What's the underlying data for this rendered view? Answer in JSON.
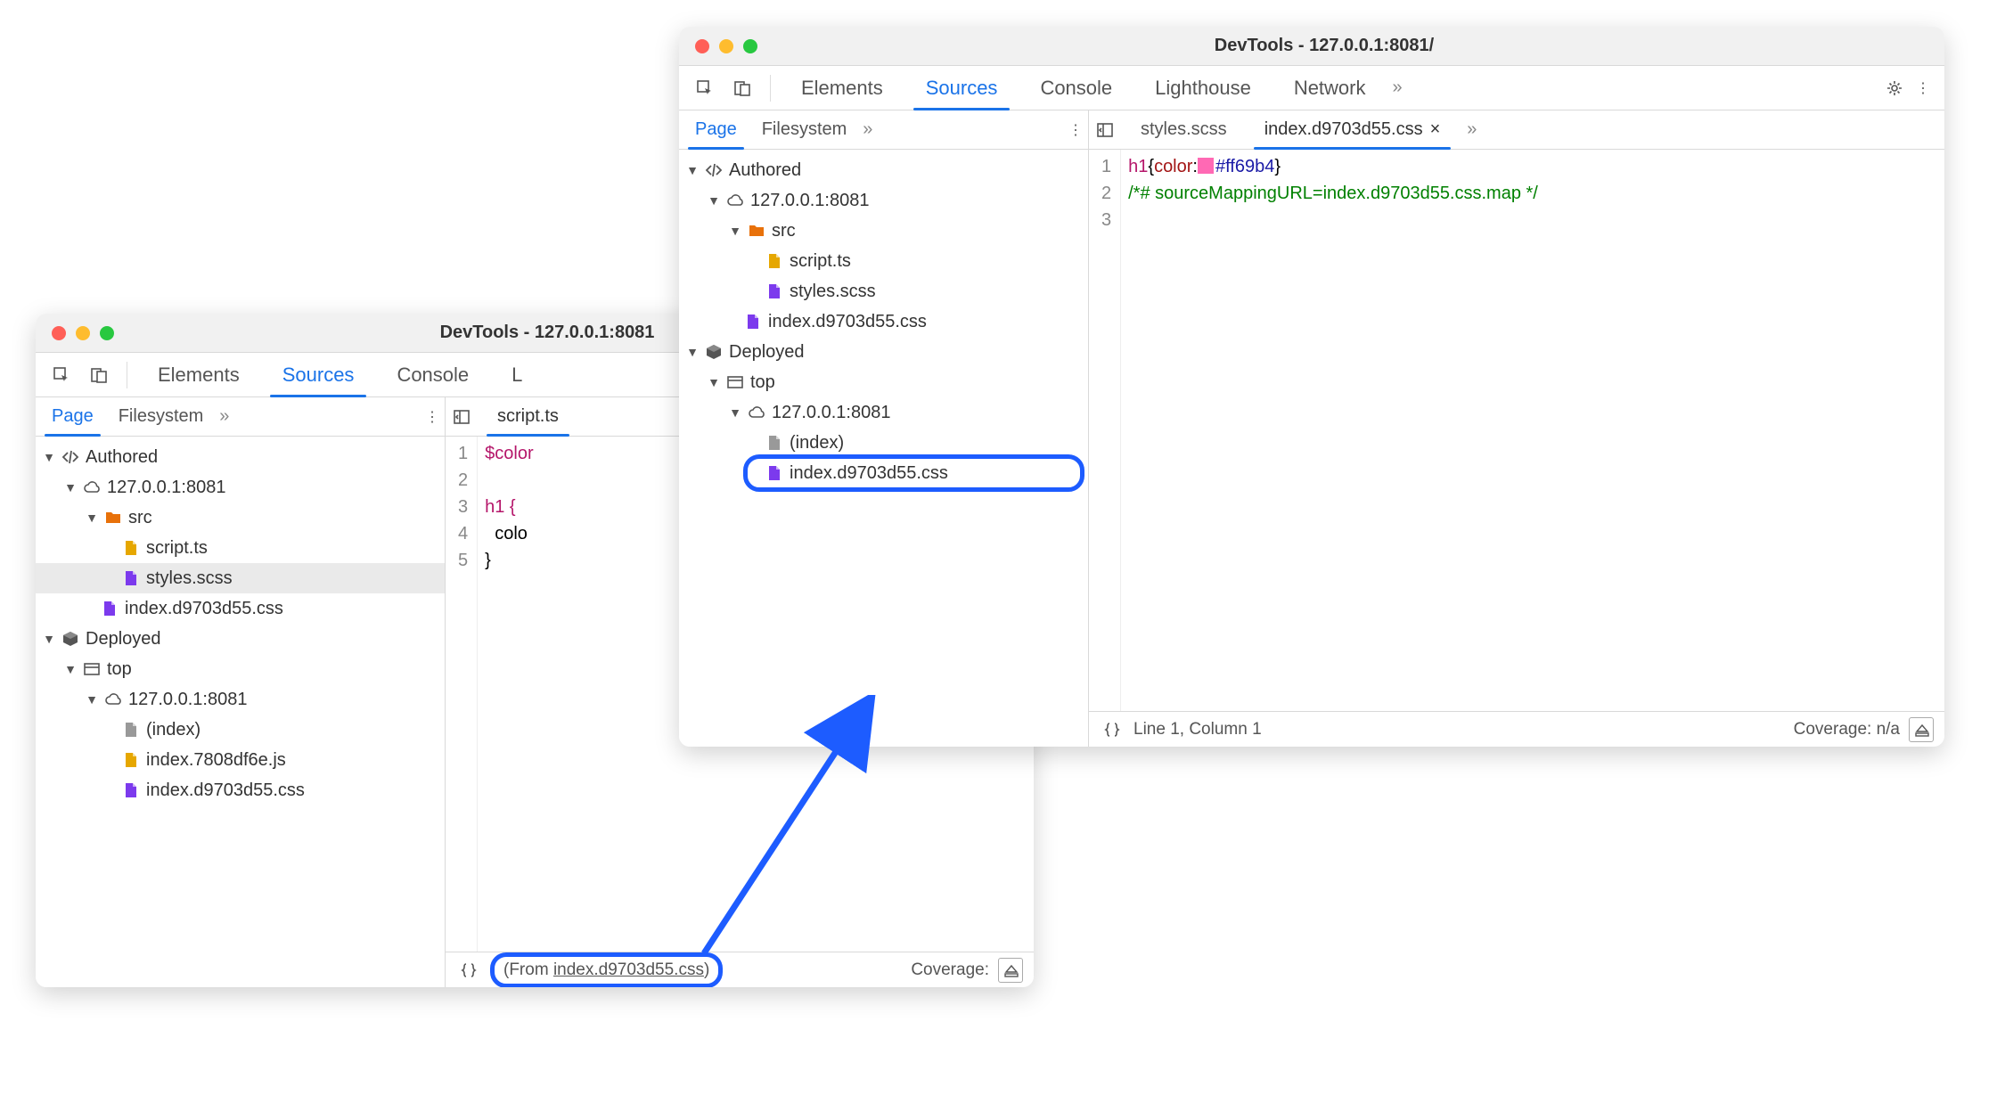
{
  "window_left": {
    "title": "DevTools - 127.0.0.1:8081",
    "main_tabs": {
      "elements": "Elements",
      "sources": "Sources",
      "console": "Console",
      "more": "L"
    },
    "page_tabs": {
      "page": "Page",
      "filesystem": "Filesystem"
    },
    "tree": {
      "authored": "Authored",
      "host": "127.0.0.1:8081",
      "src": "src",
      "script_ts": "script.ts",
      "styles_scss": "styles.scss",
      "index_css": "index.d9703d55.css",
      "deployed": "Deployed",
      "top": "top",
      "host2": "127.0.0.1:8081",
      "index": "(index)",
      "index_js": "index.7808df6e.js",
      "dep_index_css": "index.d9703d55.css"
    },
    "file_tab": "script.ts",
    "code": {
      "l1": "$color",
      "l2": "",
      "l3": "h1 {",
      "l4": "  colo",
      "l5": "}"
    },
    "status": {
      "from_prefix": "(From ",
      "from_link": "index.d9703d55.css",
      "from_suffix": ")",
      "coverage": "Coverage:"
    }
  },
  "window_right": {
    "title": "DevTools - 127.0.0.1:8081/",
    "main_tabs": {
      "elements": "Elements",
      "sources": "Sources",
      "console": "Console",
      "lighthouse": "Lighthouse",
      "network": "Network"
    },
    "page_tabs": {
      "page": "Page",
      "filesystem": "Filesystem"
    },
    "tree": {
      "authored": "Authored",
      "host": "127.0.0.1:8081",
      "src": "src",
      "script_ts": "script.ts",
      "styles_scss": "styles.scss",
      "index_css": "index.d9703d55.css",
      "deployed": "Deployed",
      "top": "top",
      "host2": "127.0.0.1:8081",
      "index": "(index)",
      "dep_index_css": "index.d9703d55.css"
    },
    "file_tabs": {
      "styles": "styles.scss",
      "index_css": "index.d9703d55.css"
    },
    "code": {
      "l1_sel": "h1",
      "l1_brace_o": "{",
      "l1_prop": "color",
      "l1_colon": ":",
      "l1_val": "#ff69b4",
      "l1_brace_c": "}",
      "l2": "/*# sourceMappingURL=index.d9703d55.css.map */"
    },
    "status": {
      "pos": "Line 1, Column 1",
      "coverage": "Coverage: n/a"
    }
  },
  "colors": {
    "hotpink": "#ff69b4"
  }
}
